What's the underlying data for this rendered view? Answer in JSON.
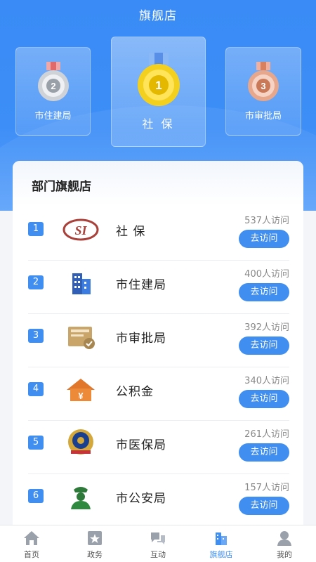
{
  "header": {
    "title": "旗舰店"
  },
  "podium": {
    "first": {
      "label": "社 保",
      "rank": "1"
    },
    "second": {
      "label": "市住建局",
      "rank": "2"
    },
    "third": {
      "label": "市审批局",
      "rank": "3"
    }
  },
  "list": {
    "title": "部门旗舰店",
    "button_label": "去访问",
    "rows": [
      {
        "rank": "1",
        "name": "社 保",
        "visits": "537人访问",
        "icon": "social-security-logo-icon"
      },
      {
        "rank": "2",
        "name": "市住建局",
        "visits": "400人访问",
        "icon": "building-icon"
      },
      {
        "rank": "3",
        "name": "市审批局",
        "visits": "392人访问",
        "icon": "approval-document-icon"
      },
      {
        "rank": "4",
        "name": "公积金",
        "visits": "340人访问",
        "icon": "housing-fund-icon"
      },
      {
        "rank": "5",
        "name": "市医保局",
        "visits": "261人访问",
        "icon": "police-emblem-icon"
      },
      {
        "rank": "6",
        "name": "市公安局",
        "visits": "157人访问",
        "icon": "officer-icon"
      }
    ]
  },
  "tabbar": {
    "items": [
      {
        "label": "首页",
        "icon": "home-icon"
      },
      {
        "label": "政务",
        "icon": "government-icon"
      },
      {
        "label": "互动",
        "icon": "interact-icon"
      },
      {
        "label": "旗舰店",
        "icon": "flagship-store-icon",
        "active": true
      },
      {
        "label": "我的",
        "icon": "profile-icon"
      }
    ]
  },
  "colors": {
    "primary": "#3f8ef0",
    "hero": "#3d8ef7"
  }
}
